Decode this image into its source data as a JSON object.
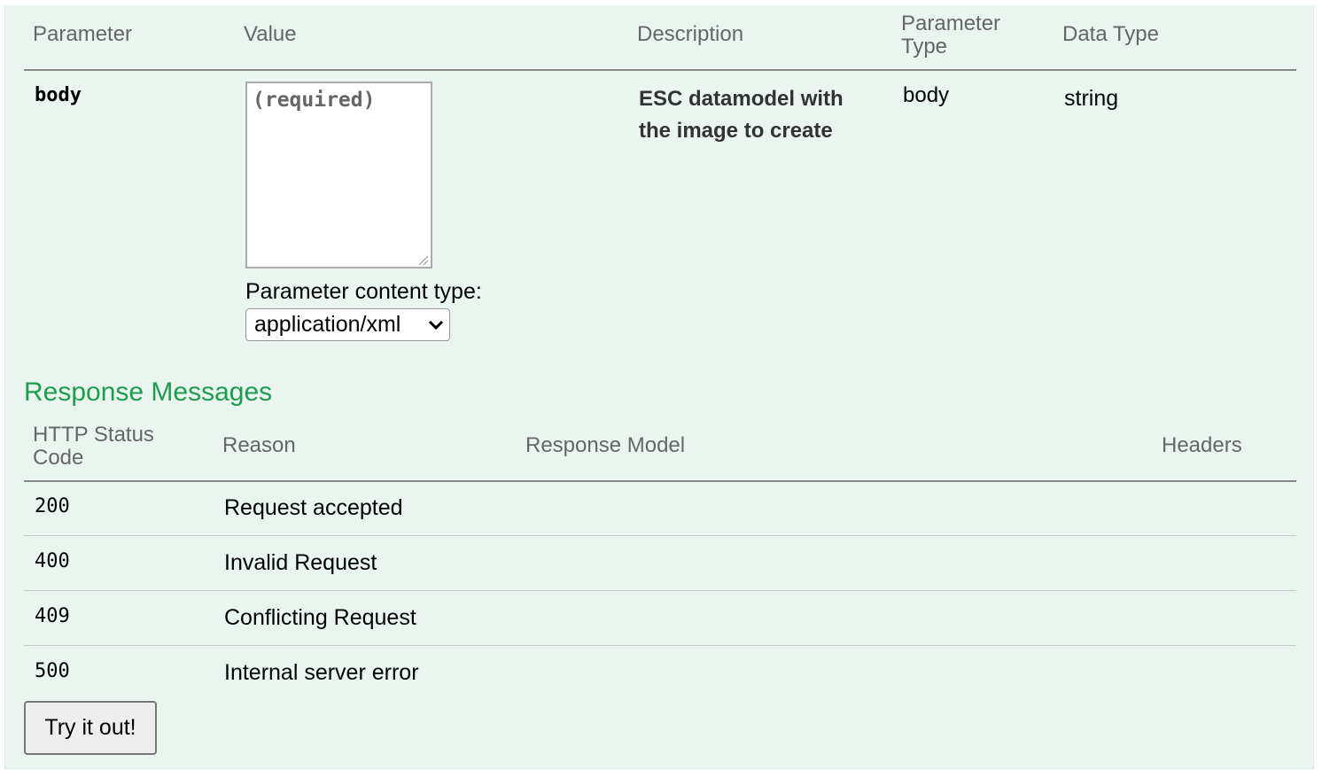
{
  "parameters_table": {
    "headers": {
      "parameter": "Parameter",
      "value": "Value",
      "description": "Description",
      "parameter_type_line1": "Parameter",
      "parameter_type_line2": "Type",
      "data_type": "Data Type"
    },
    "row": {
      "name": "body",
      "value_placeholder": "(required)",
      "description_line1": "ESC datamodel with",
      "description_line2": "the image to create",
      "parameter_type": "body",
      "data_type": "string"
    },
    "content_type_label": "Parameter content type:",
    "content_type_selected": "application/xml"
  },
  "response_messages": {
    "title": "Response Messages",
    "headers": {
      "status_code_line1": "HTTP Status",
      "status_code_line2": "Code",
      "reason": "Reason",
      "response_model": "Response Model",
      "headers": "Headers"
    },
    "rows": [
      {
        "code": "200",
        "reason": "Request accepted"
      },
      {
        "code": "400",
        "reason": "Invalid Request"
      },
      {
        "code": "409",
        "reason": "Conflicting Request"
      },
      {
        "code": "500",
        "reason": "Internal server error"
      }
    ]
  },
  "try_button_label": "Try it out!",
  "colors": {
    "panel_bg": "#ebf5f0",
    "section_title": "#1d9d4e",
    "header_text": "#666666"
  }
}
